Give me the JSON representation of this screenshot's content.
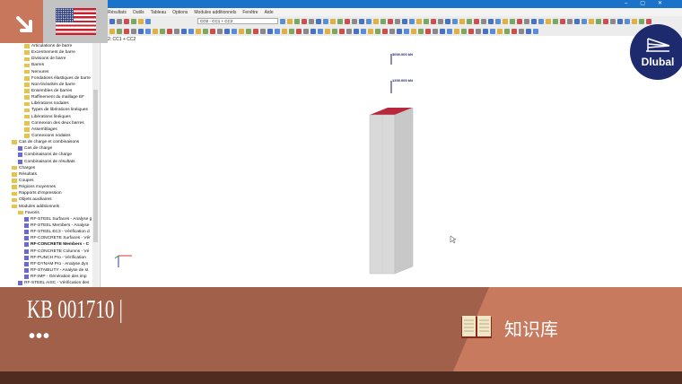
{
  "menu": [
    "Résultats",
    "Outils",
    "Tableau",
    "Options",
    "Modules additionnels",
    "Fenêtre",
    "Aide"
  ],
  "toolbar": {
    "combo_value": "CO2 - CC1 + CC2"
  },
  "canvas": {
    "label": "2: CC1 + CC2",
    "loads": [
      "3000.000 kN",
      "1200.000 kN"
    ]
  },
  "tree": [
    {
      "label": "Articulations de barre",
      "level": 3,
      "icon": "folder"
    },
    {
      "label": "Excentrement de barre",
      "level": 3,
      "icon": "folder"
    },
    {
      "label": "Divisions de barre",
      "level": 3,
      "icon": "folder"
    },
    {
      "label": "Barres",
      "level": 3,
      "icon": "folder"
    },
    {
      "label": "Nervures",
      "level": 3,
      "icon": "folder"
    },
    {
      "label": "Fondations élastiques de barre",
      "level": 3,
      "icon": "folder"
    },
    {
      "label": "Non-linéarités de barre",
      "level": 3,
      "icon": "folder"
    },
    {
      "label": "Ensembles de barres",
      "level": 3,
      "icon": "folder"
    },
    {
      "label": "Raffinement du maillage EF",
      "level": 3,
      "icon": "folder"
    },
    {
      "label": "Libérations nodales",
      "level": 3,
      "icon": "folder"
    },
    {
      "label": "Types de libérations linéiques",
      "level": 3,
      "icon": "folder"
    },
    {
      "label": "Libérations linéiques",
      "level": 3,
      "icon": "folder"
    },
    {
      "label": "Connexion des deux barres",
      "level": 3,
      "icon": "folder"
    },
    {
      "label": "Assemblages",
      "level": 3,
      "icon": "folder"
    },
    {
      "label": "Connexions nodales",
      "level": 3,
      "icon": "folder"
    },
    {
      "label": "Cas de charge et combinaisons",
      "level": 1,
      "icon": "folder"
    },
    {
      "label": "Cas de charge",
      "level": 2,
      "icon": "module"
    },
    {
      "label": "Combinaisons de charge",
      "level": 2,
      "icon": "module"
    },
    {
      "label": "Combinaisons de résultats",
      "level": 2,
      "icon": "module"
    },
    {
      "label": "Charges",
      "level": 1,
      "icon": "folder"
    },
    {
      "label": "Résultats",
      "level": 1,
      "icon": "folder"
    },
    {
      "label": "Coupes",
      "level": 1,
      "icon": "folder"
    },
    {
      "label": "Régions moyennes",
      "level": 1,
      "icon": "folder"
    },
    {
      "label": "Rapports d'impression",
      "level": 1,
      "icon": "folder"
    },
    {
      "label": "Objets auxiliaires",
      "level": 1,
      "icon": "folder"
    },
    {
      "label": "Modules additionnels",
      "level": 1,
      "icon": "folder"
    },
    {
      "label": "Favoris",
      "level": 2,
      "icon": "folder"
    },
    {
      "label": "RF-STEEL Surfaces - Analyse g",
      "level": 3,
      "icon": "module"
    },
    {
      "label": "RF-STEEL Members - Analyse",
      "level": 3,
      "icon": "module"
    },
    {
      "label": "RF-STEEL EC3 - Vérification d",
      "level": 3,
      "icon": "module"
    },
    {
      "label": "RF-CONCRETE Surfaces - Vér",
      "level": 3,
      "icon": "module"
    },
    {
      "label": "RF-CONCRETE Members - C",
      "level": 3,
      "icon": "module",
      "bold": true
    },
    {
      "label": "RF-CONCRETE Columns - Vé",
      "level": 3,
      "icon": "module"
    },
    {
      "label": "RF-PUNCH Pro - Vérification",
      "level": 3,
      "icon": "module"
    },
    {
      "label": "RF-DYNAM Pro - Analyse dyn",
      "level": 3,
      "icon": "module"
    },
    {
      "label": "RF-STABILITY - Analyse de st",
      "level": 3,
      "icon": "module"
    },
    {
      "label": "RF-IMP - Génération des imp",
      "level": 3,
      "icon": "module"
    },
    {
      "label": "RF-STEEL AISC - Vérification des",
      "level": 2,
      "icon": "module"
    }
  ],
  "banner": {
    "code": "KB 001710",
    "dots": "•••",
    "category": "知识库"
  },
  "logo": {
    "text": "Dlubal"
  },
  "colors": {
    "banner": "#a0604a",
    "banner_right": "#c87a5e",
    "titlebar": "#1a73c9",
    "logo": "#1e2a6e"
  }
}
